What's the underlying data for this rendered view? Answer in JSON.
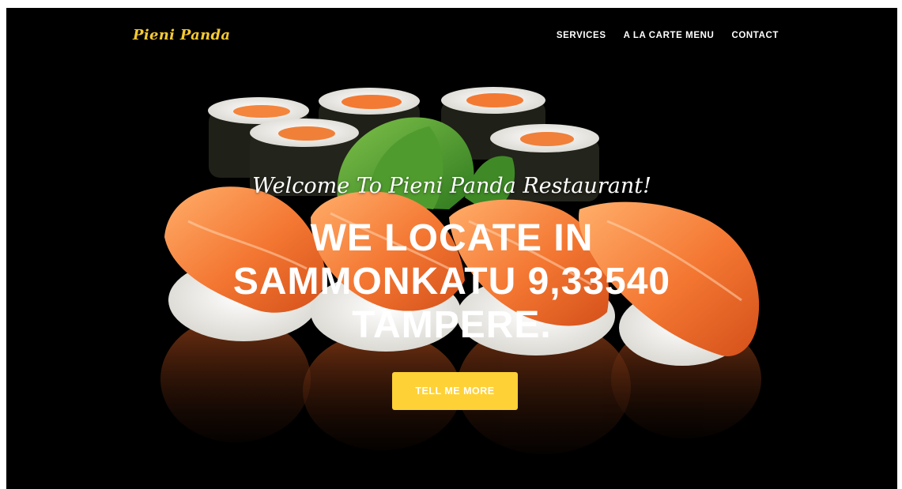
{
  "brand": {
    "name": "Pieni Panda",
    "color": "#f5c932"
  },
  "nav": {
    "items": [
      {
        "label": "SERVICES"
      },
      {
        "label": "A LA CARTE MENU"
      },
      {
        "label": "CONTACT"
      }
    ]
  },
  "hero": {
    "lead": "Welcome To Pieni Panda Restaurant!",
    "heading_lines": [
      "WE LOCATE IN",
      "SAMMONKATU 9,33540",
      "TAMPERE."
    ],
    "cta_label": "TELL ME MORE",
    "cta_color": "#fed136",
    "background_image": "sushi-photo"
  }
}
